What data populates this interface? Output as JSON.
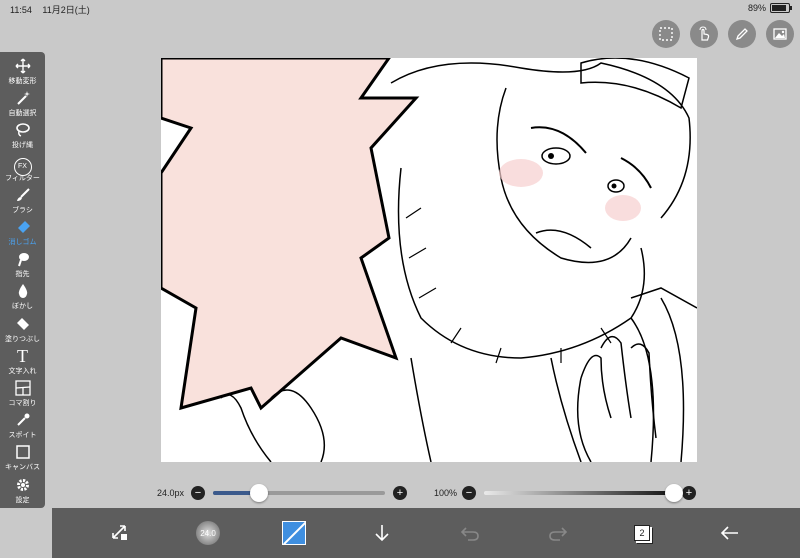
{
  "status_bar": {
    "time": "11:54",
    "date": "11月2日(土)",
    "battery": "89%",
    "battery_level": 0.89
  },
  "toolbar": {
    "tools": [
      {
        "label": "移動変形",
        "icon": "move-icon"
      },
      {
        "label": "自動選択",
        "icon": "magic-wand-icon"
      },
      {
        "label": "投げ縄",
        "icon": "lasso-icon"
      },
      {
        "label": "フィルター",
        "icon": "fx-icon",
        "glyph": "FX"
      },
      {
        "label": "ブラシ",
        "icon": "brush-icon"
      },
      {
        "label": "消しゴム",
        "icon": "eraser-icon",
        "active": true
      },
      {
        "label": "指先",
        "icon": "finger-icon"
      },
      {
        "label": "ぼかし",
        "icon": "blur-drop-icon"
      },
      {
        "label": "塗りつぶし",
        "icon": "fill-bucket-icon"
      },
      {
        "label": "文字入れ",
        "icon": "text-icon",
        "glyph": "T"
      },
      {
        "label": "コマ割り",
        "icon": "frame-divider-icon"
      },
      {
        "label": "スポイト",
        "icon": "eyedropper-icon"
      },
      {
        "label": "キャンバス",
        "icon": "canvas-icon"
      },
      {
        "label": "設定",
        "icon": "gear-icon"
      }
    ],
    "active_color": "#4aa3f2"
  },
  "top_tools": [
    "selection-icon",
    "touch-gesture-icon",
    "pen-icon",
    "image-icon"
  ],
  "brush_size": {
    "label": "24.0px",
    "value": 24.0,
    "fraction": 0.27
  },
  "opacity": {
    "label": "100%",
    "fraction": 1.0
  },
  "bottom_bar": {
    "brush_preview_label": "24.0",
    "layer_count": "2",
    "color": "#3f8fe0"
  }
}
